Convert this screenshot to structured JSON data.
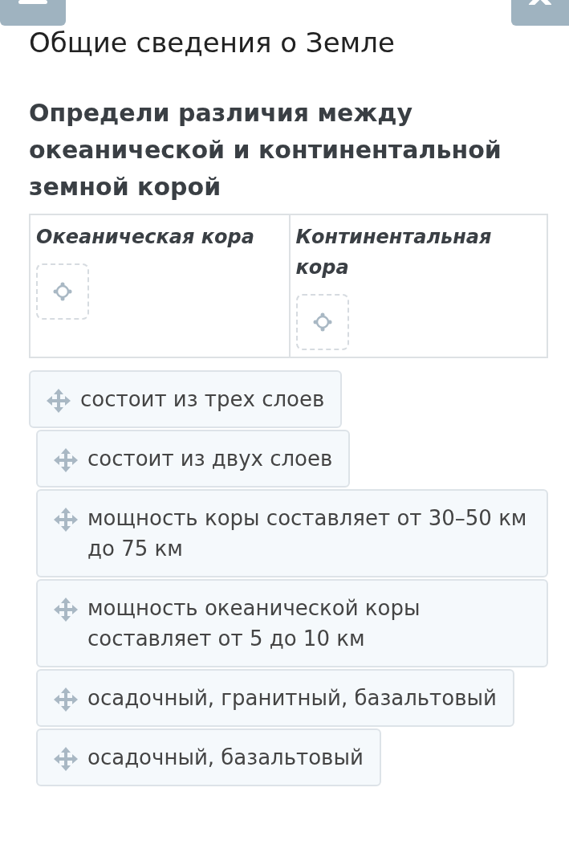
{
  "title": "Общие сведения о Земле",
  "question": "Определи различия между океанической и континентальной земной корой",
  "columns": [
    {
      "heading": "Океаническая кора"
    },
    {
      "heading": "Континентальная кора"
    }
  ],
  "items": [
    {
      "text": "состоит из трех слоев"
    },
    {
      "text": "состоит из двух слоев"
    },
    {
      "text": "мощность коры составляет от 30–50 км до 75 км"
    },
    {
      "text": "мощность океанической коры составляет от 5 до 10 км"
    },
    {
      "text": "осадочный, гранитный, базальтовый"
    },
    {
      "text": "осадочный, базальтовый"
    }
  ]
}
